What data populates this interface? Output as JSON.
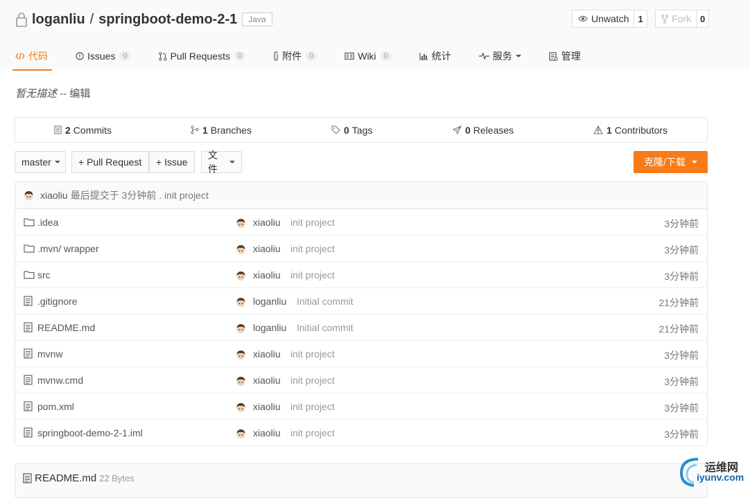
{
  "repo": {
    "owner": "loganliu",
    "separator": "/",
    "name": "springboot-demo-2-1",
    "language": "Java"
  },
  "actions": {
    "watch": {
      "label": "Unwatch",
      "count": "1",
      "icon": "eye-icon"
    },
    "fork": {
      "label": "Fork",
      "count": "0",
      "icon": "fork-icon"
    }
  },
  "tabs": [
    {
      "label": "代码",
      "icon": "code-icon",
      "active": true
    },
    {
      "label": "Issues",
      "badge": "0",
      "icon": "issue-icon"
    },
    {
      "label": "Pull Requests",
      "badge": "0",
      "icon": "pull-request-icon"
    },
    {
      "label": "附件",
      "badge": "0",
      "icon": "paperclip-icon"
    },
    {
      "label": "Wiki",
      "badge": "0",
      "icon": "book-icon"
    },
    {
      "label": "统计",
      "icon": "graph-icon"
    },
    {
      "label": "服务",
      "icon": "pulse-icon"
    },
    {
      "label": "管理",
      "icon": "settings-icon"
    }
  ],
  "description": {
    "text": "暂无描述",
    "separator": "--",
    "edit_label": "编辑"
  },
  "stats": [
    {
      "count": "2",
      "label": "Commits",
      "icon": "commits-icon"
    },
    {
      "count": "1",
      "label": "Branches",
      "icon": "branch-icon"
    },
    {
      "count": "0",
      "label": "Tags",
      "icon": "tag-icon"
    },
    {
      "count": "0",
      "label": "Releases",
      "icon": "release-icon"
    },
    {
      "count": "1",
      "label": "Contributors",
      "icon": "contributors-icon"
    }
  ],
  "toolbar": {
    "branch_label": "master",
    "pull_request_label": "+ Pull Request",
    "issue_label": "+ Issue",
    "files_label": "文件",
    "clone_label": "克隆/下载"
  },
  "last_commit": {
    "author": "xiaoliu",
    "text": "最后提交于 3分钟前 . init project"
  },
  "files": [
    {
      "name": ".idea",
      "type": "folder",
      "author": "xiaoliu",
      "message": "init project",
      "time": "3分钟前"
    },
    {
      "name": ".mvn/ wrapper",
      "type": "folder",
      "author": "xiaoliu",
      "message": "init project",
      "time": "3分钟前"
    },
    {
      "name": "src",
      "type": "folder",
      "author": "xiaoliu",
      "message": "init project",
      "time": "3分钟前"
    },
    {
      "name": ".gitignore",
      "type": "file",
      "author": "loganliu",
      "message": "Initial commit",
      "time": "21分钟前"
    },
    {
      "name": "README.md",
      "type": "file",
      "author": "loganliu",
      "message": "Initial commit",
      "time": "21分钟前"
    },
    {
      "name": "mvnw",
      "type": "file",
      "author": "xiaoliu",
      "message": "init project",
      "time": "3分钟前"
    },
    {
      "name": "mvnw.cmd",
      "type": "file",
      "author": "xiaoliu",
      "message": "init project",
      "time": "3分钟前"
    },
    {
      "name": "pom.xml",
      "type": "file",
      "author": "xiaoliu",
      "message": "init project",
      "time": "3分钟前"
    },
    {
      "name": "springboot-demo-2-1.iml",
      "type": "file",
      "author": "xiaoliu",
      "message": "init project",
      "time": "3分钟前"
    }
  ],
  "readme": {
    "title": "README.md",
    "size": "22 Bytes"
  },
  "watermark": {
    "cn": "运维网",
    "en": "iyunv.com"
  },
  "colors": {
    "accent": "#f77b17",
    "border": "#e5e5e5",
    "watermark_blue": "#1565a8"
  }
}
